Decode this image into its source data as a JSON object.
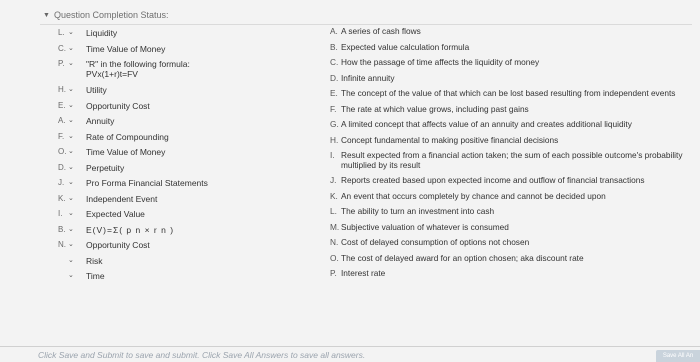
{
  "header": {
    "title": "Question Completion Status:"
  },
  "left_items": [
    {
      "letter": "L.",
      "term": "Liquidity"
    },
    {
      "letter": "C.",
      "term": "Time Value of Money"
    },
    {
      "letter": "P.",
      "term": "\"R\" in the following formula:",
      "sub": "PVx(1+r)t=FV"
    },
    {
      "letter": "H.",
      "term": "Utility"
    },
    {
      "letter": "E.",
      "term": "Opportunity Cost"
    },
    {
      "letter": "A.",
      "term": "Annuity"
    },
    {
      "letter": "F.",
      "term": "Rate of Compounding"
    },
    {
      "letter": "O.",
      "term": "Time Value of Money"
    },
    {
      "letter": "D.",
      "term": "Perpetuity"
    },
    {
      "letter": "J.",
      "term": "Pro Forma Financial Statements"
    },
    {
      "letter": "K.",
      "term": "Independent Event"
    },
    {
      "letter": "I.",
      "term": "Expected Value"
    },
    {
      "letter": "B.",
      "term": "E(V)=Σ( p n × r n )"
    },
    {
      "letter": "N.",
      "term": "Opportunity Cost"
    },
    {
      "letter": "",
      "term": "Risk"
    },
    {
      "letter": "",
      "term": "Time"
    }
  ],
  "options": [
    {
      "letter": "A.",
      "text": "A series of cash flows"
    },
    {
      "letter": "B.",
      "text": "Expected value calculation formula"
    },
    {
      "letter": "C.",
      "text": "How the passage of time affects the liquidity of money"
    },
    {
      "letter": "D.",
      "text": "Infinite annuity"
    },
    {
      "letter": "E.",
      "text": "The concept of the value of that which can be lost based resulting from independent events"
    },
    {
      "letter": "F.",
      "text": "The rate at which value grows, including past gains"
    },
    {
      "letter": "G.",
      "text": "A limited concept that affects value of an annuity and creates additional liquidity"
    },
    {
      "letter": "H.",
      "text": "Concept fundamental to making positive financial decisions"
    },
    {
      "letter": "I.",
      "text": "Result expected from a financial action taken; the sum of each possible outcome's probability multiplied by its result"
    },
    {
      "letter": "J.",
      "text": "Reports created based upon expected income and outflow of financial transactions"
    },
    {
      "letter": "K.",
      "text": "An event that occurs completely by chance and cannot be decided upon"
    },
    {
      "letter": "L.",
      "text": "The ability to turn an investment into cash"
    },
    {
      "letter": "M.",
      "text": "Subjective valuation of whatever is consumed"
    },
    {
      "letter": "N.",
      "text": "Cost of delayed consumption of options not chosen"
    },
    {
      "letter": "O.",
      "text": "The cost of delayed award for an option chosen; aka discount rate"
    },
    {
      "letter": "P.",
      "text": "Interest rate"
    }
  ],
  "footer": {
    "text": "Click Save and Submit to save and submit. Click Save All Answers to save all answers.",
    "save_all_label": "Save All An"
  }
}
